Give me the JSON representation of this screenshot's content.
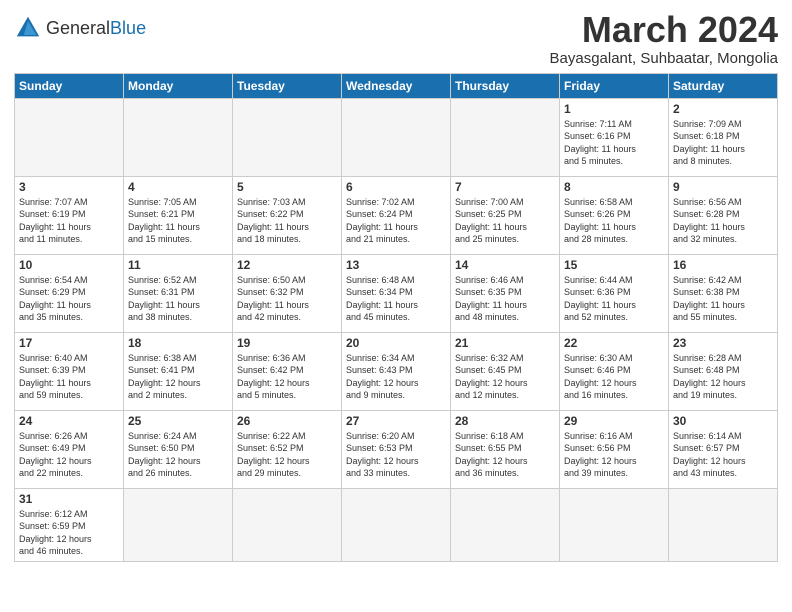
{
  "logo": {
    "text_general": "General",
    "text_blue": "Blue"
  },
  "title": "March 2024",
  "subtitle": "Bayasgalant, Suhbaatar, Mongolia",
  "weekdays": [
    "Sunday",
    "Monday",
    "Tuesday",
    "Wednesday",
    "Thursday",
    "Friday",
    "Saturday"
  ],
  "weeks": [
    [
      {
        "day": "",
        "info": ""
      },
      {
        "day": "",
        "info": ""
      },
      {
        "day": "",
        "info": ""
      },
      {
        "day": "",
        "info": ""
      },
      {
        "day": "",
        "info": ""
      },
      {
        "day": "1",
        "info": "Sunrise: 7:11 AM\nSunset: 6:16 PM\nDaylight: 11 hours\nand 5 minutes."
      },
      {
        "day": "2",
        "info": "Sunrise: 7:09 AM\nSunset: 6:18 PM\nDaylight: 11 hours\nand 8 minutes."
      }
    ],
    [
      {
        "day": "3",
        "info": "Sunrise: 7:07 AM\nSunset: 6:19 PM\nDaylight: 11 hours\nand 11 minutes."
      },
      {
        "day": "4",
        "info": "Sunrise: 7:05 AM\nSunset: 6:21 PM\nDaylight: 11 hours\nand 15 minutes."
      },
      {
        "day": "5",
        "info": "Sunrise: 7:03 AM\nSunset: 6:22 PM\nDaylight: 11 hours\nand 18 minutes."
      },
      {
        "day": "6",
        "info": "Sunrise: 7:02 AM\nSunset: 6:24 PM\nDaylight: 11 hours\nand 21 minutes."
      },
      {
        "day": "7",
        "info": "Sunrise: 7:00 AM\nSunset: 6:25 PM\nDaylight: 11 hours\nand 25 minutes."
      },
      {
        "day": "8",
        "info": "Sunrise: 6:58 AM\nSunset: 6:26 PM\nDaylight: 11 hours\nand 28 minutes."
      },
      {
        "day": "9",
        "info": "Sunrise: 6:56 AM\nSunset: 6:28 PM\nDaylight: 11 hours\nand 32 minutes."
      }
    ],
    [
      {
        "day": "10",
        "info": "Sunrise: 6:54 AM\nSunset: 6:29 PM\nDaylight: 11 hours\nand 35 minutes."
      },
      {
        "day": "11",
        "info": "Sunrise: 6:52 AM\nSunset: 6:31 PM\nDaylight: 11 hours\nand 38 minutes."
      },
      {
        "day": "12",
        "info": "Sunrise: 6:50 AM\nSunset: 6:32 PM\nDaylight: 11 hours\nand 42 minutes."
      },
      {
        "day": "13",
        "info": "Sunrise: 6:48 AM\nSunset: 6:34 PM\nDaylight: 11 hours\nand 45 minutes."
      },
      {
        "day": "14",
        "info": "Sunrise: 6:46 AM\nSunset: 6:35 PM\nDaylight: 11 hours\nand 48 minutes."
      },
      {
        "day": "15",
        "info": "Sunrise: 6:44 AM\nSunset: 6:36 PM\nDaylight: 11 hours\nand 52 minutes."
      },
      {
        "day": "16",
        "info": "Sunrise: 6:42 AM\nSunset: 6:38 PM\nDaylight: 11 hours\nand 55 minutes."
      }
    ],
    [
      {
        "day": "17",
        "info": "Sunrise: 6:40 AM\nSunset: 6:39 PM\nDaylight: 11 hours\nand 59 minutes."
      },
      {
        "day": "18",
        "info": "Sunrise: 6:38 AM\nSunset: 6:41 PM\nDaylight: 12 hours\nand 2 minutes."
      },
      {
        "day": "19",
        "info": "Sunrise: 6:36 AM\nSunset: 6:42 PM\nDaylight: 12 hours\nand 5 minutes."
      },
      {
        "day": "20",
        "info": "Sunrise: 6:34 AM\nSunset: 6:43 PM\nDaylight: 12 hours\nand 9 minutes."
      },
      {
        "day": "21",
        "info": "Sunrise: 6:32 AM\nSunset: 6:45 PM\nDaylight: 12 hours\nand 12 minutes."
      },
      {
        "day": "22",
        "info": "Sunrise: 6:30 AM\nSunset: 6:46 PM\nDaylight: 12 hours\nand 16 minutes."
      },
      {
        "day": "23",
        "info": "Sunrise: 6:28 AM\nSunset: 6:48 PM\nDaylight: 12 hours\nand 19 minutes."
      }
    ],
    [
      {
        "day": "24",
        "info": "Sunrise: 6:26 AM\nSunset: 6:49 PM\nDaylight: 12 hours\nand 22 minutes."
      },
      {
        "day": "25",
        "info": "Sunrise: 6:24 AM\nSunset: 6:50 PM\nDaylight: 12 hours\nand 26 minutes."
      },
      {
        "day": "26",
        "info": "Sunrise: 6:22 AM\nSunset: 6:52 PM\nDaylight: 12 hours\nand 29 minutes."
      },
      {
        "day": "27",
        "info": "Sunrise: 6:20 AM\nSunset: 6:53 PM\nDaylight: 12 hours\nand 33 minutes."
      },
      {
        "day": "28",
        "info": "Sunrise: 6:18 AM\nSunset: 6:55 PM\nDaylight: 12 hours\nand 36 minutes."
      },
      {
        "day": "29",
        "info": "Sunrise: 6:16 AM\nSunset: 6:56 PM\nDaylight: 12 hours\nand 39 minutes."
      },
      {
        "day": "30",
        "info": "Sunrise: 6:14 AM\nSunset: 6:57 PM\nDaylight: 12 hours\nand 43 minutes."
      }
    ],
    [
      {
        "day": "31",
        "info": "Sunrise: 6:12 AM\nSunset: 6:59 PM\nDaylight: 12 hours\nand 46 minutes."
      },
      {
        "day": "",
        "info": ""
      },
      {
        "day": "",
        "info": ""
      },
      {
        "day": "",
        "info": ""
      },
      {
        "day": "",
        "info": ""
      },
      {
        "day": "",
        "info": ""
      },
      {
        "day": "",
        "info": ""
      }
    ]
  ]
}
